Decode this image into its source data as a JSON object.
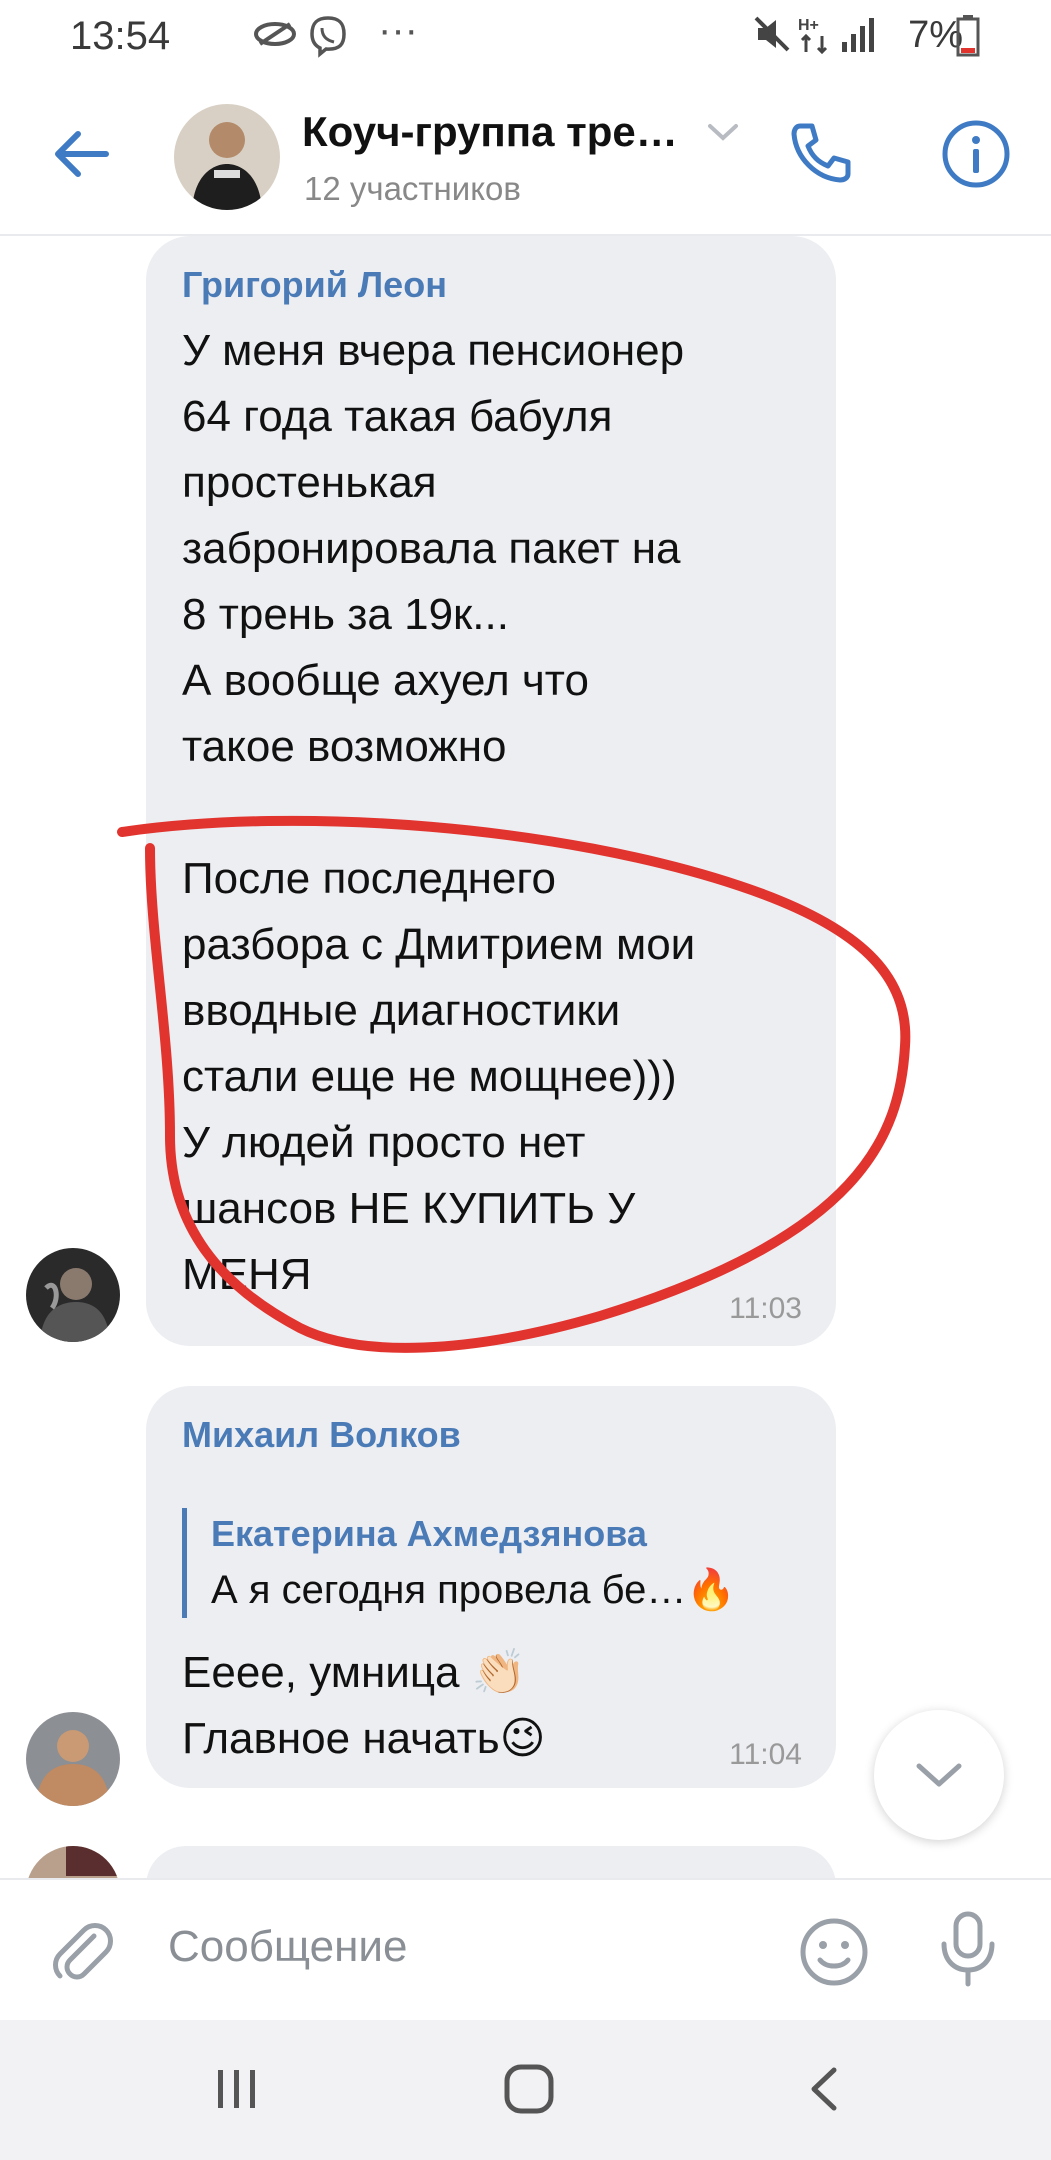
{
  "status_bar": {
    "time": "13:54",
    "battery": "7%",
    "dots": "···"
  },
  "header": {
    "title": "Коуч-группа тре…",
    "subtitle": "12 участников"
  },
  "messages": [
    {
      "sender": "Григорий Леон",
      "text": "У меня вчера пенсионер\n64 года такая бабуля\nпростенькая\nзабронировала пакет на\n8 трень за 19к...\nА вообще ахуел что\nтакое возможно\n\nПосле последнего\nразбора с Дмитрием мои\nвводные диагностики\nстали еще не мощнее)))\nУ людей просто нет\nшансов НЕ КУПИТЬ У\nМЕНЯ",
      "time": "11:03"
    },
    {
      "sender": "Михаил Волков",
      "quote_author": "Екатерина Ахмедзянова",
      "quote_text": "А я сегодня провела бе…🔥",
      "text": "Ееее, умница 👏🏻\nГлавное начать😉",
      "time": "11:04"
    }
  ],
  "composer": {
    "placeholder": "Сообщение"
  },
  "colors": {
    "accent": "#3f7bc4",
    "bubble": "#eceef2",
    "annotation": "#e2342f"
  },
  "icons": [
    "back-arrow-icon",
    "chevron-down-icon",
    "phone-icon",
    "info-icon",
    "paperclip-icon",
    "emoji-icon",
    "microphone-icon",
    "scroll-down-icon"
  ]
}
